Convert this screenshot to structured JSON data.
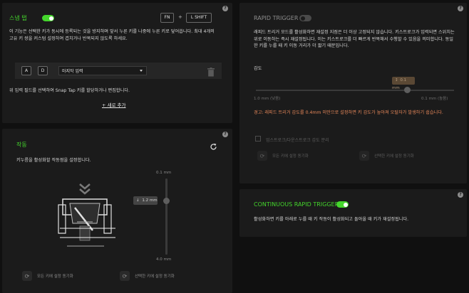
{
  "snap_tap": {
    "title": "스냅 탭",
    "enabled": true,
    "key_fn": "FN",
    "plus": "+",
    "key_shift": "L SHIFT",
    "help": "?",
    "description": "이 기능은 선택한 키가 동시에 등록되는 것을 방지하며 앞서 누른 키를 나중에 누른 키로 덮어씁니다. 최대 4개의 고유 키 쌍을 커스텀 설정하여 겹치거나 반복되지 않도록 하세요.",
    "pair": {
      "key1": "A",
      "key2": "D",
      "mode_value": "마지막 입력"
    },
    "hint": "위 입력 필드를 선택하여 Snap Tap 키를 할당하거나 편집합니다.",
    "add_new": "+ 새로 추가"
  },
  "actuation": {
    "title": "작동",
    "help": "?",
    "description": "키누름을 활성화할 작동점을 설정합니다.",
    "slider_top": "0.1 mm",
    "slider_bottom": "4.0 mm",
    "value_label": "1.2 mm",
    "actuation_mm": 1.2,
    "reset_all": "모든 키에 설정 동기화",
    "reset_selected": "선택한 키에 설정 동기화"
  },
  "rapid_trigger": {
    "title": "RAPID TRIGGER",
    "enabled": false,
    "help": "?",
    "description": "래피드 트리거 모드를 활성화하면 재설정 지점은 더 이상 고정되지 않습니다. 키스트로크가 입력되면 스위치는 위로 이동하는 즉시 재설정됩니다. 이는 키스트로크를 더 빠르게 반복해서 수행할 수 있음을 의미합니다. 동일한 키를 누를 때 키 이동 거리가 더 짧기 때문입니다.",
    "sensitivity_label": "감도",
    "value_label": "0.1 mm",
    "sensitivity_mm": 0.1,
    "left_label": "1.0 mm (낮음)",
    "right_label": "0.1 mm (높음)",
    "warning": "경고: 래피드 트리거 감도를 0.4mm 미만으로 설정하면 키 감도가 높아져 오탈자가 발생하기 쉽습니다.",
    "checkbox_label": "업스트로크/다운스트로크 감도 분리",
    "reset_all": "모든 키에 설정 동기화",
    "reset_selected": "선택한 키에 설정 동기화"
  },
  "continuous": {
    "title": "CONTINUOUS RAPID TRIGGER",
    "enabled": true,
    "help": "?",
    "description": "활성화하면 키를 아래로 누를 때 키 작동이 활성화되고 돌아올 때 키가 재설정됩니다."
  }
}
